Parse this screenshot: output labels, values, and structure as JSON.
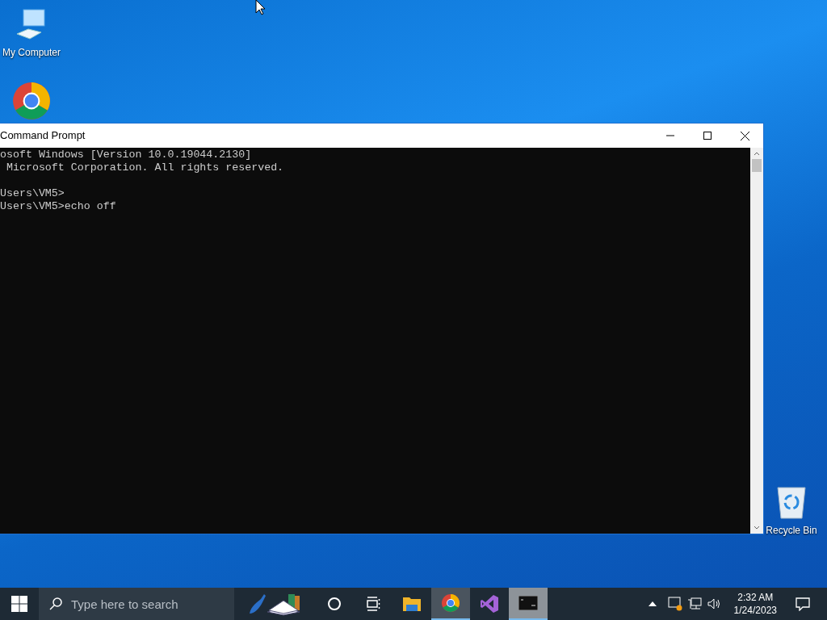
{
  "desktop_icons": [
    {
      "kind": "computer",
      "label": "My Computer"
    },
    {
      "kind": "chrome"
    },
    {
      "kind": "recycle",
      "label": "Recycle Bin"
    }
  ],
  "window": {
    "title": "Command Prompt",
    "blocks": [
      [
        "osoft Windows [Version 10.0.19044.2130]",
        " Microsoft Corporation. All rights reserved."
      ],
      [
        "Users\\VM5>",
        "Users\\VM5>echo off"
      ]
    ]
  },
  "taskbar": {
    "search": {
      "placeholder": "Type here to search"
    },
    "apps": [
      {
        "kind": "books",
        "running": false,
        "selected": false
      },
      {
        "kind": "cortana",
        "running": false,
        "selected": false
      },
      {
        "kind": "taskview",
        "running": false,
        "selected": false
      },
      {
        "kind": "folder",
        "running": false,
        "selected": false
      },
      {
        "kind": "chrome",
        "running": true,
        "selected": false
      },
      {
        "kind": "vs",
        "running": false,
        "selected": false
      },
      {
        "kind": "cmd",
        "running": true,
        "selected": true
      }
    ],
    "clock": {
      "time": "2:32 AM",
      "date": "1/24/2023"
    }
  }
}
